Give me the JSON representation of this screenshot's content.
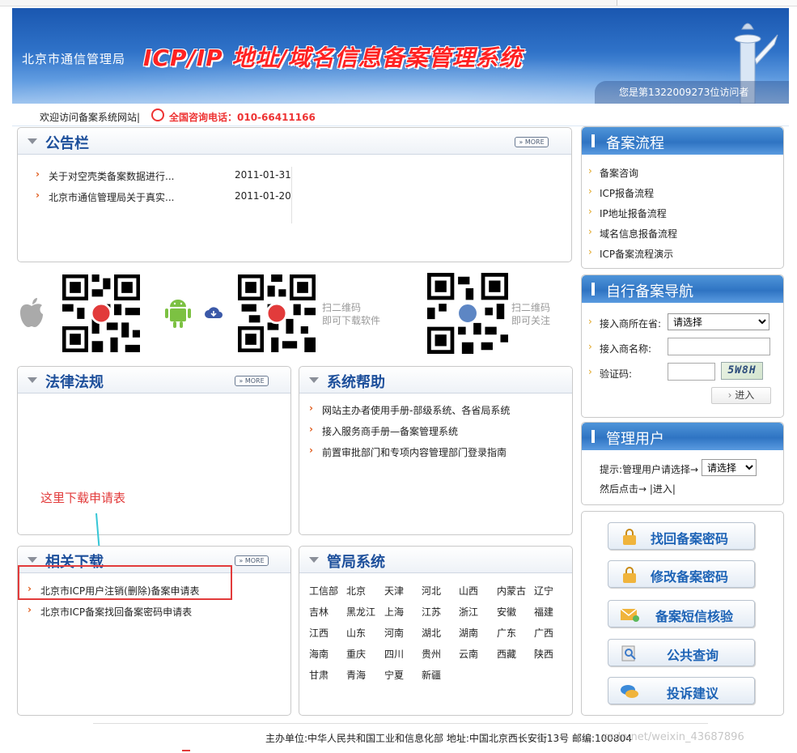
{
  "header": {
    "org": "北京市通信管理局",
    "title": "ICP/IP 地址/域名信息备案管理系统",
    "visitor": "您是第1322009273位访问者"
  },
  "welcome": {
    "text": "欢迎访问备案系统网站|",
    "hotline": "全国咨询电话：010-66411166"
  },
  "bulletin": {
    "title": "公告栏",
    "more": "» MORE",
    "items": [
      {
        "text": "关于对空壳类备案数据进行...",
        "date": "2011-01-31"
      },
      {
        "text": "北京市通信管理局关于真实...",
        "date": "2011-01-20"
      }
    ]
  },
  "qr": {
    "download_text": "扫二维码\n即可下载软件",
    "follow_text": "扫二维码\n即可关注",
    "download_line1": "扫二维码",
    "download_line2": "即可下载软件",
    "follow_line1": "扫二维码",
    "follow_line2": "即可关注"
  },
  "law": {
    "title": "法律法规",
    "more": "» MORE"
  },
  "help": {
    "title": "系统帮助",
    "items": [
      "网站主办者使用手册-部级系统、各省局系统",
      "接入服务商手册—备案管理系统",
      "前置审批部门和专项内容管理部门登录指南"
    ]
  },
  "annotation": {
    "note": "这里下载申请表"
  },
  "downloads": {
    "title": "相关下载",
    "more": "» MORE",
    "items": [
      "北京市ICP用户注销(删除)备案申请表",
      "北京市ICP备案找回备案密码申请表"
    ]
  },
  "bureau": {
    "title": "管局系统",
    "rows": [
      [
        "工信部",
        "北京",
        "天津",
        "河北",
        "山西",
        "内蒙古",
        "辽宁"
      ],
      [
        "吉林",
        "黑龙江",
        "上海",
        "江苏",
        "浙江",
        "安徽",
        "福建"
      ],
      [
        "江西",
        "山东",
        "河南",
        "湖北",
        "湖南",
        "广东",
        "广西"
      ],
      [
        "海南",
        "重庆",
        "四川",
        "贵州",
        "云南",
        "西藏",
        "陕西"
      ],
      [
        "甘肃",
        "青海",
        "宁夏",
        "新疆"
      ]
    ]
  },
  "process": {
    "title": "备案流程",
    "items": [
      "备案咨询",
      "ICP报备流程",
      "IP地址报备流程",
      "域名信息报备流程",
      "ICP备案流程演示"
    ]
  },
  "selfnav": {
    "title": "自行备案导航",
    "province_label": "接入商所在省:",
    "province_value": "请选择",
    "name_label": "接入商名称:",
    "captcha_label": "验证码:",
    "captcha_text": "5W8H",
    "enter": "进入"
  },
  "admin": {
    "title": "管理用户",
    "hint": "提示:管理用户请选择→",
    "select_value": "请选择",
    "then": "然后点击→ |进入|"
  },
  "actions": [
    "找回备案密码",
    "修改备案密码",
    "备案短信核验",
    "公共查询",
    "投诉建议"
  ],
  "footer": {
    "text": "主办单位:中华人民共和国工业和信息化部 地址:中国北京西长安街13号 邮编:100804",
    "watermark": "csdn.net/weixin_43687896"
  },
  "colors": {
    "accent": "#1d4f9b",
    "banner": "#2f72c8",
    "highlight": "#e23b3b"
  }
}
